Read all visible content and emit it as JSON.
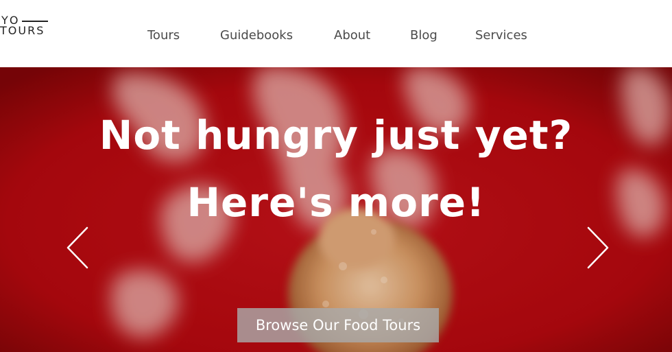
{
  "brand": {
    "line1": "YO",
    "line2": "TOURS"
  },
  "nav": {
    "items": [
      {
        "label": "Tours"
      },
      {
        "label": "Guidebooks"
      },
      {
        "label": "About"
      },
      {
        "label": "Blog"
      },
      {
        "label": "Services"
      }
    ]
  },
  "hero": {
    "title_line1": "Not hungry just yet?",
    "title_line2": "Here's more!",
    "cta_label": "Browse Our Food Tours",
    "prev_icon": "chevron-left-icon",
    "next_icon": "chevron-right-icon",
    "background_color": "#b3090e"
  }
}
